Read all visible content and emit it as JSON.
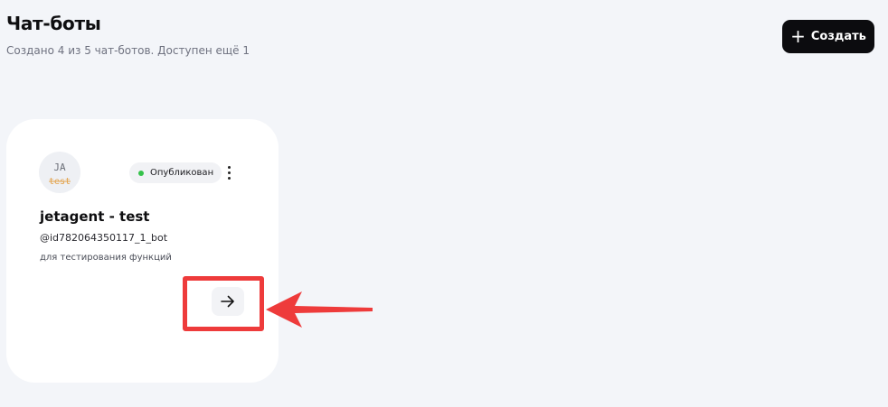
{
  "header": {
    "title": "Чат-боты",
    "subtitle": "Создано 4 из 5 чат-ботов. Доступен ещё 1",
    "create_button": {
      "label": "Создать",
      "icon": "plus-icon"
    }
  },
  "bots": [
    {
      "avatar": {
        "icon": "bot-avatar",
        "line1": "JA",
        "line2": "test"
      },
      "status": {
        "label": "Опубликован",
        "color": "#35c24a"
      },
      "name": "jetagent - test",
      "handle": "@id782064350117_1_bot",
      "description": "для тестирования функций",
      "open_icon": "arrow-right-icon",
      "menu_icon": "more-vertical-icon"
    }
  ],
  "annotation": {
    "color": "#ee3b3b",
    "shape": "arrow-left"
  }
}
